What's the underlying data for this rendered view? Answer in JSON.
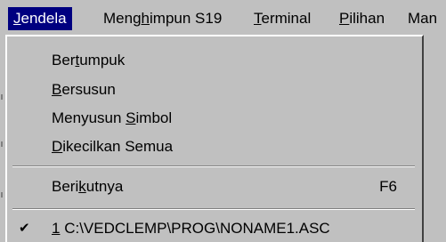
{
  "menubar": {
    "items": [
      {
        "pre": "",
        "u": "J",
        "post": "endela"
      },
      {
        "pre": "Meng",
        "u": "h",
        "post": "impun S19"
      },
      {
        "pre": "",
        "u": "T",
        "post": "erminal"
      },
      {
        "pre": "",
        "u": "P",
        "post": "ilihan"
      },
      {
        "pre": "Man",
        "u": "",
        "post": ""
      }
    ]
  },
  "dropdown": {
    "arrange": [
      {
        "pre": "Ber",
        "u": "t",
        "post": "umpuk"
      },
      {
        "pre": "",
        "u": "B",
        "post": "ersusun"
      },
      {
        "pre": "Menyusun ",
        "u": "S",
        "post": "imbol"
      },
      {
        "pre": "",
        "u": "D",
        "post": "ikecilkan Semua"
      }
    ],
    "next": {
      "pre": "Beri",
      "u": "k",
      "post": "utnya",
      "shortcut": "F6"
    },
    "recent": {
      "check": "✔",
      "number": "1",
      "path": " C:\\VEDCLEMP\\PROG\\NONAME1.ASC"
    }
  }
}
